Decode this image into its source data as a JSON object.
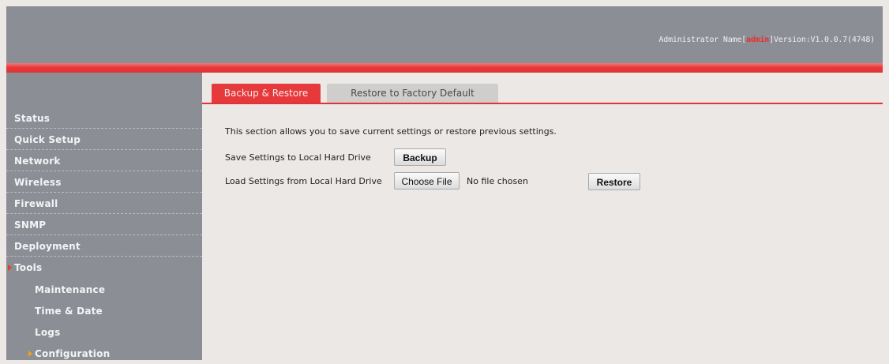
{
  "header": {
    "admin_prefix": "Administrator Name[",
    "admin_name": "admin",
    "version_text": "]Version:V1.0.0.7(4748)"
  },
  "colors": {
    "accent": "#e5393b",
    "sidebar_bg": "#8b8e95",
    "content_bg": "#ebe8e5"
  },
  "sidebar": {
    "items": [
      {
        "label": "Status"
      },
      {
        "label": "Quick Setup"
      },
      {
        "label": "Network"
      },
      {
        "label": "Wireless"
      },
      {
        "label": "Firewall"
      },
      {
        "label": "SNMP"
      },
      {
        "label": "Deployment"
      },
      {
        "label": "Tools",
        "expanded": true
      },
      {
        "label": "Maintenance"
      },
      {
        "label": "Time & Date"
      },
      {
        "label": "Logs"
      },
      {
        "label": "Configuration",
        "selected": true
      }
    ]
  },
  "tabs": [
    {
      "label": "Backup & Restore",
      "active": true
    },
    {
      "label": "Restore to Factory Default",
      "active": false
    }
  ],
  "main": {
    "intro": "This section allows you to save current settings or restore previous settings.",
    "save_label": "Save Settings to Local Hard Drive",
    "backup_button": "Backup",
    "load_label": "Load Settings from Local Hard Drive",
    "choose_file_button": "Choose File",
    "no_file_text": "No file chosen",
    "restore_button": "Restore"
  }
}
